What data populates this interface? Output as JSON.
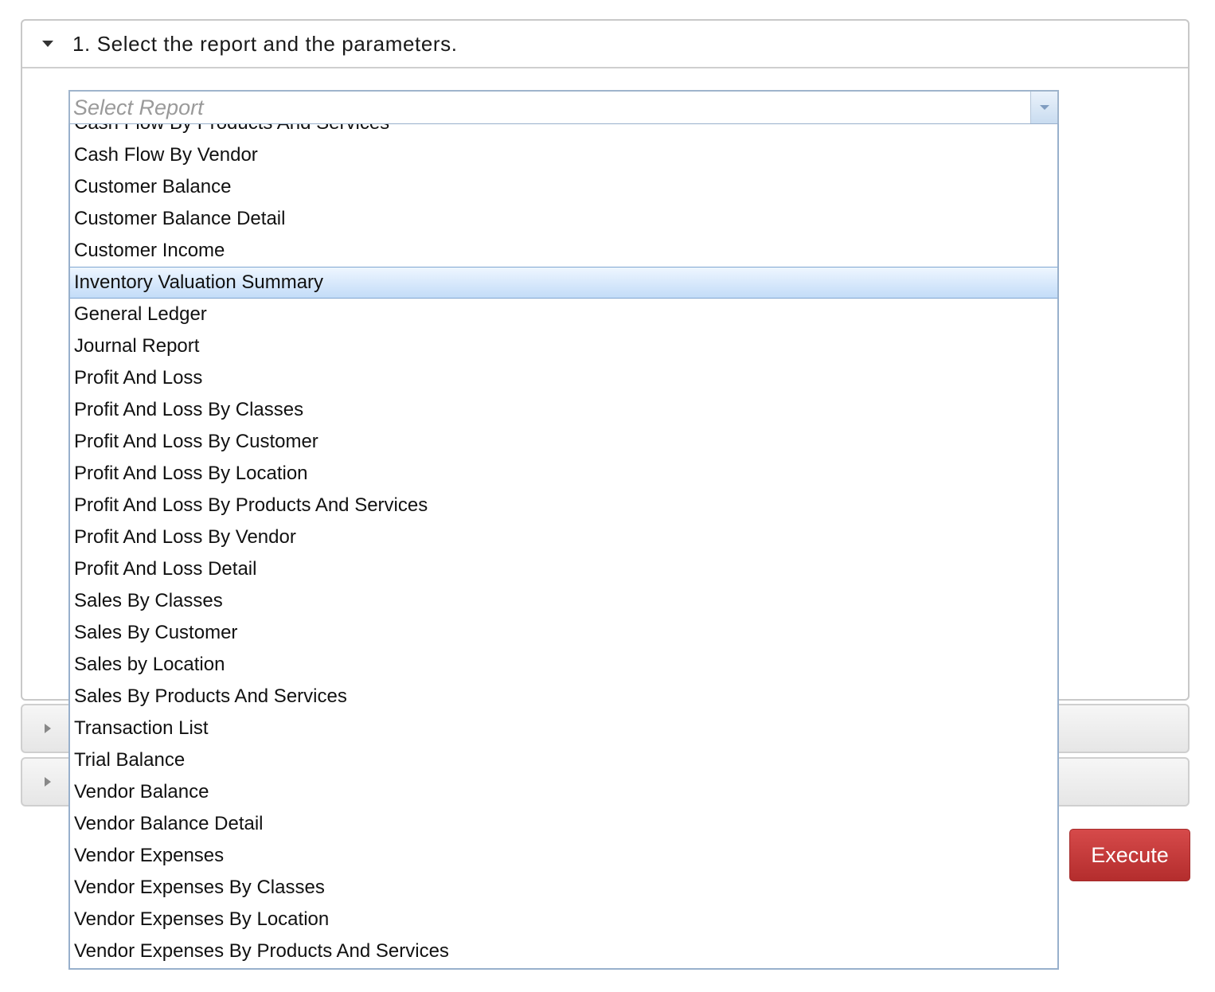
{
  "panel1": {
    "title": "1. Select the report and the parameters.",
    "icon": "triangle-down-icon"
  },
  "report_select": {
    "placeholder": "Select Report",
    "value": ""
  },
  "dropdown": {
    "highlighted": "Inventory Valuation Summary",
    "options": [
      "Cash Flow By Products And Services",
      "Cash Flow By Vendor",
      "Customer Balance",
      "Customer Balance Detail",
      "Customer Income",
      "Inventory Valuation Summary",
      "General Ledger",
      "Journal Report",
      "Profit And Loss",
      "Profit And Loss By Classes",
      "Profit And Loss By Customer",
      "Profit And Loss By Location",
      "Profit And Loss By Products And Services",
      "Profit And Loss By Vendor",
      "Profit And Loss Detail",
      "Sales By Classes",
      "Sales By Customer",
      "Sales by Location",
      "Sales By Products And Services",
      "Transaction List",
      "Trial Balance",
      "Vendor Balance",
      "Vendor Balance Detail",
      "Vendor Expenses",
      "Vendor Expenses By Classes",
      "Vendor Expenses By Location",
      "Vendor Expenses By Products And Services"
    ]
  },
  "collapsed_panels": [
    {
      "icon": "triangle-right-icon"
    },
    {
      "icon": "triangle-right-icon"
    }
  ],
  "actions": {
    "execute_label": "Execute"
  },
  "colors": {
    "execute_bg": "#c0392b",
    "selected_row": "#c3dcf8",
    "combo_border": "#9fb4cc"
  }
}
